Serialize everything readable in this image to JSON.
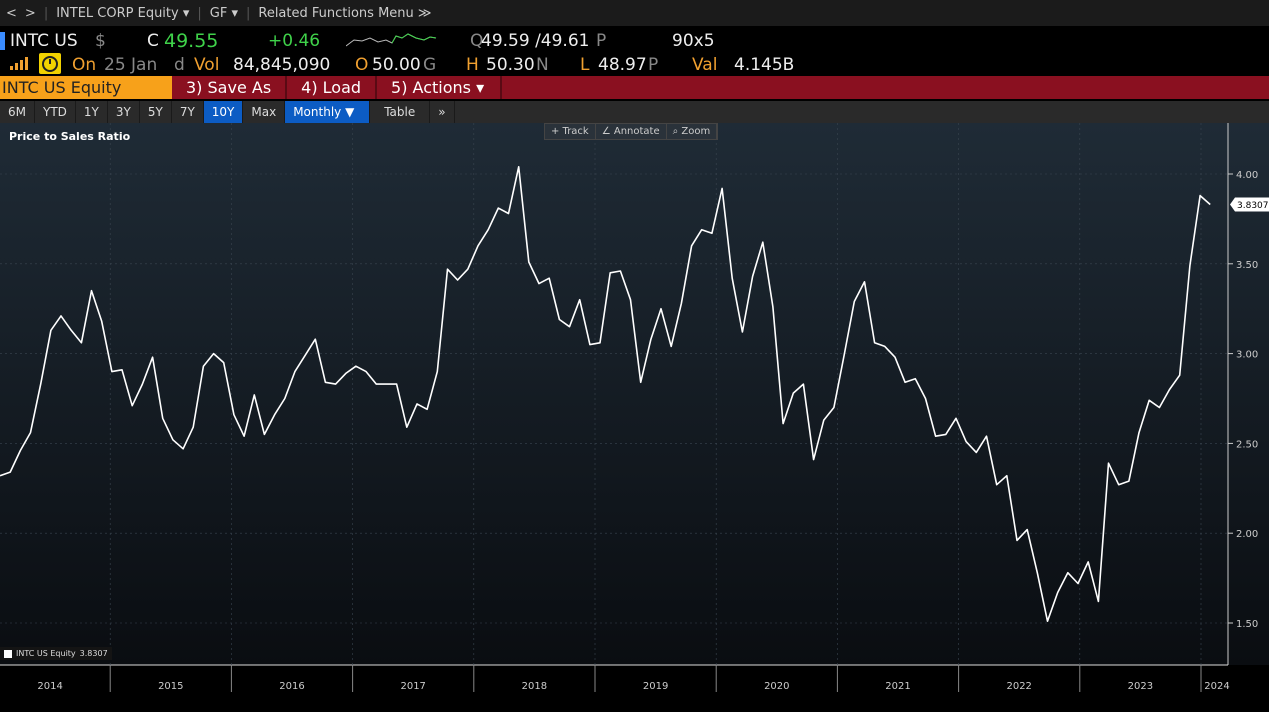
{
  "nav": {
    "back": "<",
    "forward": ">",
    "security": "INTEL CORP Equity ▾",
    "function": "GF ▾",
    "related": "Related Functions Menu ≫"
  },
  "quote": {
    "ticker": "INTC US",
    "currency": "$",
    "c_label": "C",
    "last": "49.55",
    "change": "+0.46",
    "bid_ask_prefix": "Q",
    "bid_ask": "49.59 /49.61",
    "bid_ask_suffix": "P",
    "size": "90x5",
    "on_label": "On",
    "date": "25 Jan",
    "d": "d",
    "vol_label": "Vol",
    "volume": "84,845,090",
    "open_label": "O",
    "open": "50.00",
    "open_suffix": "G",
    "high_label": "H",
    "high": "50.30",
    "high_suffix": "N",
    "low_label": "L",
    "low": "48.97",
    "low_suffix": "P",
    "val_label": "Val",
    "value": "4.145B"
  },
  "toolbar": {
    "security": "INTC US Equity",
    "save_as": "3) Save As",
    "load": "4) Load",
    "actions": "5) Actions ▾"
  },
  "periods": [
    "6M",
    "YTD",
    "1Y",
    "3Y",
    "5Y",
    "7Y",
    "10Y",
    "Max"
  ],
  "selected_period": "10Y",
  "frequency": "Monthly ▼",
  "table": "Table",
  "more": "»",
  "chart_tools": [
    "+ Track",
    "∠ Annotate",
    "⌕ Zoom"
  ],
  "colors": {
    "accent": "#f7a11a",
    "toolbar": "#8a1020",
    "selected": "#0c5cc4",
    "line": "#ffffff",
    "up": "#3fd24a"
  },
  "chart_data": {
    "type": "line",
    "title": "Price to Sales Ratio",
    "legend": {
      "label": "INTC US Equity",
      "last": "3.8307",
      "placement": "bottom-left"
    },
    "last_value_label": "3.8307",
    "x_start": "2014-02",
    "frequency": "monthly",
    "xticks": [
      "2014",
      "2015",
      "2016",
      "2017",
      "2018",
      "2019",
      "2020",
      "2021",
      "2022",
      "2023",
      "2024"
    ],
    "yticks": [
      "1.50",
      "2.00",
      "2.50",
      "3.00",
      "3.50",
      "4.00"
    ],
    "ylim": [
      1.36,
      4.28
    ],
    "values": [
      2.32,
      2.34,
      2.46,
      2.56,
      2.83,
      3.13,
      3.21,
      3.13,
      3.06,
      3.35,
      3.18,
      2.9,
      2.91,
      2.71,
      2.83,
      2.98,
      2.64,
      2.52,
      2.47,
      2.59,
      2.93,
      3.0,
      2.95,
      2.66,
      2.54,
      2.77,
      2.55,
      2.66,
      2.75,
      2.9,
      2.99,
      3.08,
      2.84,
      2.83,
      2.89,
      2.93,
      2.9,
      2.83,
      2.83,
      2.83,
      2.59,
      2.72,
      2.69,
      2.9,
      3.47,
      3.41,
      3.47,
      3.6,
      3.69,
      3.81,
      3.78,
      4.04,
      3.51,
      3.39,
      3.42,
      3.19,
      3.15,
      3.3,
      3.05,
      3.06,
      3.45,
      3.46,
      3.3,
      2.84,
      3.08,
      3.25,
      3.04,
      3.28,
      3.6,
      3.69,
      3.67,
      3.92,
      3.42,
      3.12,
      3.43,
      3.62,
      3.26,
      2.61,
      2.78,
      2.83,
      2.41,
      2.63,
      2.7,
      2.99,
      3.29,
      3.4,
      3.06,
      3.04,
      2.98,
      2.84,
      2.86,
      2.75,
      2.54,
      2.55,
      2.64,
      2.51,
      2.45,
      2.54,
      2.27,
      2.32,
      1.96,
      2.02,
      1.78,
      1.51,
      1.67,
      1.78,
      1.72,
      1.84,
      1.62,
      2.39,
      2.27,
      2.29,
      2.56,
      2.74,
      2.7,
      2.8,
      2.88,
      3.49,
      3.88,
      3.83
    ]
  }
}
